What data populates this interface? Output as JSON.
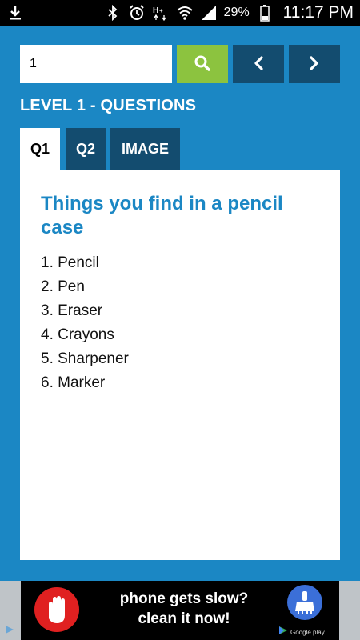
{
  "status_bar": {
    "battery_percent": "29%",
    "time": "11:17 PM",
    "icons": [
      "download-icon",
      "bluetooth-icon",
      "alarm-icon",
      "hspa-icon",
      "wifi-icon",
      "signal-icon",
      "battery-icon"
    ]
  },
  "search": {
    "value": "1"
  },
  "toolbar": {
    "search_icon": "search-icon",
    "prev_icon": "chevron-left-icon",
    "next_icon": "chevron-right-icon"
  },
  "level_title": "LEVEL 1 - QUESTIONS",
  "tabs": [
    {
      "label": "Q1",
      "active": true
    },
    {
      "label": "Q2",
      "active": false
    },
    {
      "label": "IMAGE",
      "active": false
    }
  ],
  "question": {
    "title": "Things you find in a pencil case",
    "answers": [
      "1. Pencil",
      "2. Pen",
      "3. Eraser",
      "4. Crayons",
      "5. Sharpener",
      "6. Marker"
    ]
  },
  "ad": {
    "line1": "phone gets slow?",
    "line2": "clean it now!",
    "store_label": "Google play"
  },
  "colors": {
    "background": "#1b87c4",
    "search_button": "#8cc33f",
    "nav_button": "#134c6f",
    "title_blue": "#1b87c4"
  }
}
